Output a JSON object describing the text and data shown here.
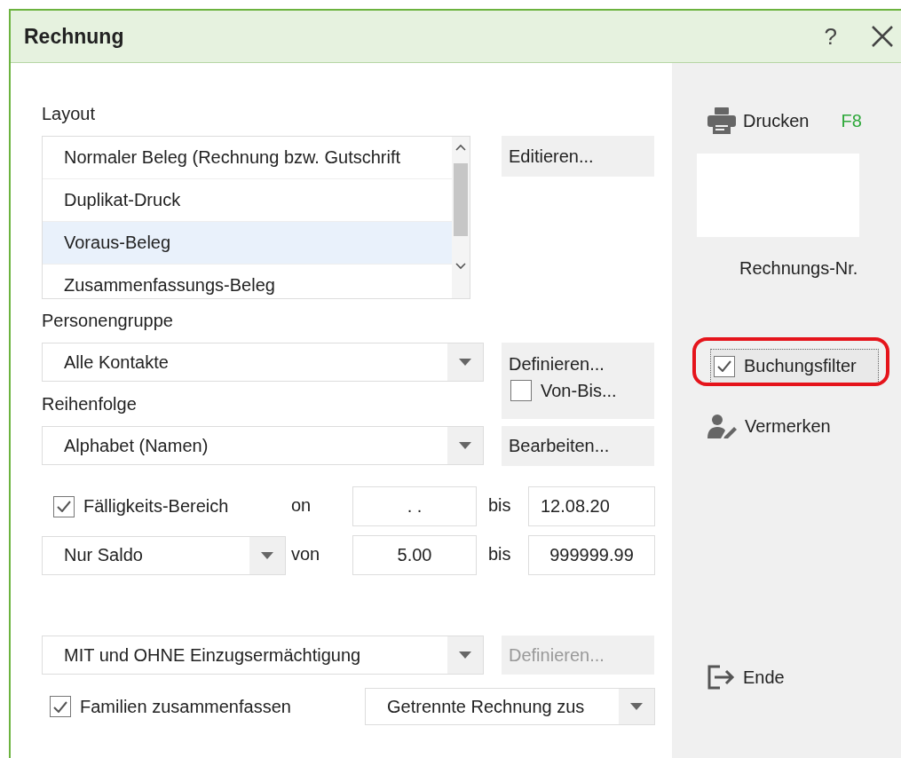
{
  "window": {
    "title": "Rechnung",
    "help": "?"
  },
  "layout": {
    "label": "Layout",
    "items": [
      {
        "label": "Normaler Beleg (Rechnung bzw. Gutschrift",
        "selected": false
      },
      {
        "label": "Duplikat-Druck",
        "selected": false
      },
      {
        "label": "Voraus-Beleg",
        "selected": true
      },
      {
        "label": "Zusammenfassungs-Beleg",
        "selected": false
      }
    ],
    "edit_button": "Editieren..."
  },
  "person_group": {
    "label": "Personengruppe",
    "value": "Alle Kontakte",
    "define_button": "Definieren...",
    "range_checkbox": {
      "label": "Von-Bis...",
      "checked": false
    }
  },
  "order": {
    "label": "Reihenfolge",
    "value": "Alphabet (Namen)",
    "edit_button": "Bearbeiten..."
  },
  "due_range": {
    "checkbox": {
      "label": "Fälligkeits-Bereich",
      "checked": true
    },
    "from_label": "on",
    "from_value": ". .",
    "to_label": "bis",
    "to_value": "12.08.20"
  },
  "balance": {
    "value": "Nur Saldo",
    "from_label": "von",
    "from_value": "5.00",
    "to_label": "bis",
    "to_value": "999999.99"
  },
  "mandate": {
    "value": "MIT und OHNE Einzugsermächtigung",
    "define_button": {
      "label": "Definieren...",
      "disabled": true
    }
  },
  "families": {
    "checkbox": {
      "label": "Familien zusammenfassen",
      "checked": true
    },
    "value": "Getrennte Rechnung zus"
  },
  "sidebar": {
    "print_button": "Drucken",
    "print_shortcut": "F8",
    "invoice_number_label": "Rechnungs-Nr.",
    "booking_filter": {
      "label": "Buchungsfilter",
      "checked": true,
      "highlighted": true
    },
    "notes_button": "Vermerken",
    "end_button": "Ende"
  }
}
